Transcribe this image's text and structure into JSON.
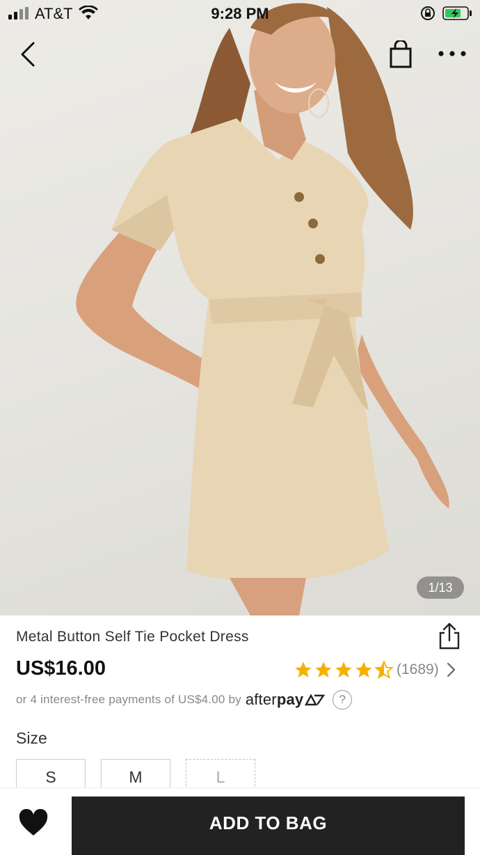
{
  "status_bar": {
    "carrier": "AT&T",
    "time": "9:28 PM"
  },
  "gallery": {
    "counter": "1/13"
  },
  "product": {
    "title": "Metal Button Self Tie Pocket Dress",
    "price": "US$16.00",
    "rating": {
      "stars": 4.5,
      "count": "(1689)"
    },
    "installments": {
      "text": "or 4 interest-free payments of US$4.00 by",
      "brand_light": "after",
      "brand_bold": "pay",
      "help": "?"
    }
  },
  "sizes": {
    "label": "Size",
    "options": [
      {
        "label": "S",
        "available": true
      },
      {
        "label": "M",
        "available": true
      },
      {
        "label": "L",
        "available": false
      }
    ]
  },
  "actions": {
    "add_to_bag": "ADD TO BAG"
  },
  "colors": {
    "star": "#f5b100",
    "button": "#222222",
    "battery": "#34c759"
  }
}
